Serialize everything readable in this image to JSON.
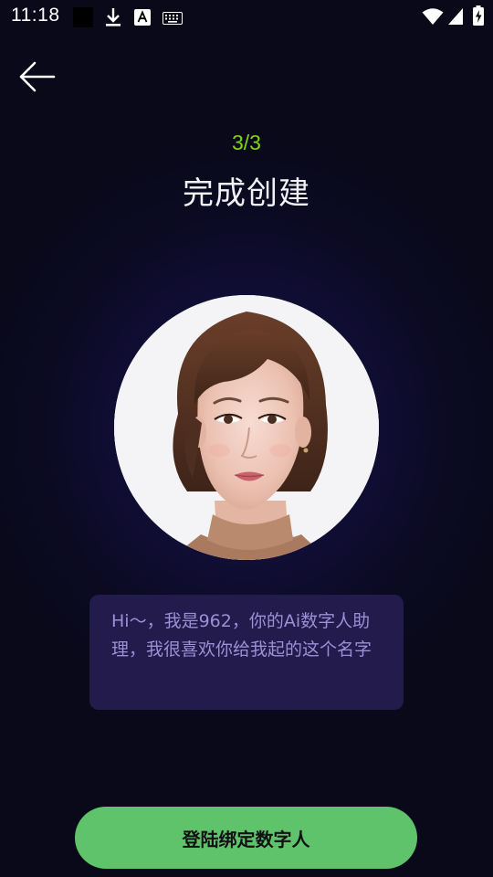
{
  "status_bar": {
    "time": "11:18",
    "icons": [
      "square-notification-icon",
      "download-icon",
      "font-a-icon",
      "keyboard-icon",
      "wifi-icon",
      "signal-icon",
      "battery-charging-icon"
    ]
  },
  "header": {
    "back_icon": "arrow-left-icon",
    "step": "3/3",
    "title": "完成创建"
  },
  "avatar": {
    "description_icon": "digital-human-portrait"
  },
  "message": {
    "text": "Hi～，我是962，你的Ai数字人助理，我很喜欢你给我起的这个名字"
  },
  "action": {
    "bind_label": "登陆绑定数字人"
  },
  "colors": {
    "accent_green": "#7fd414",
    "button_green": "#5ec36b",
    "card_bg": "#221b4c",
    "message_text": "#9c8fd6"
  }
}
